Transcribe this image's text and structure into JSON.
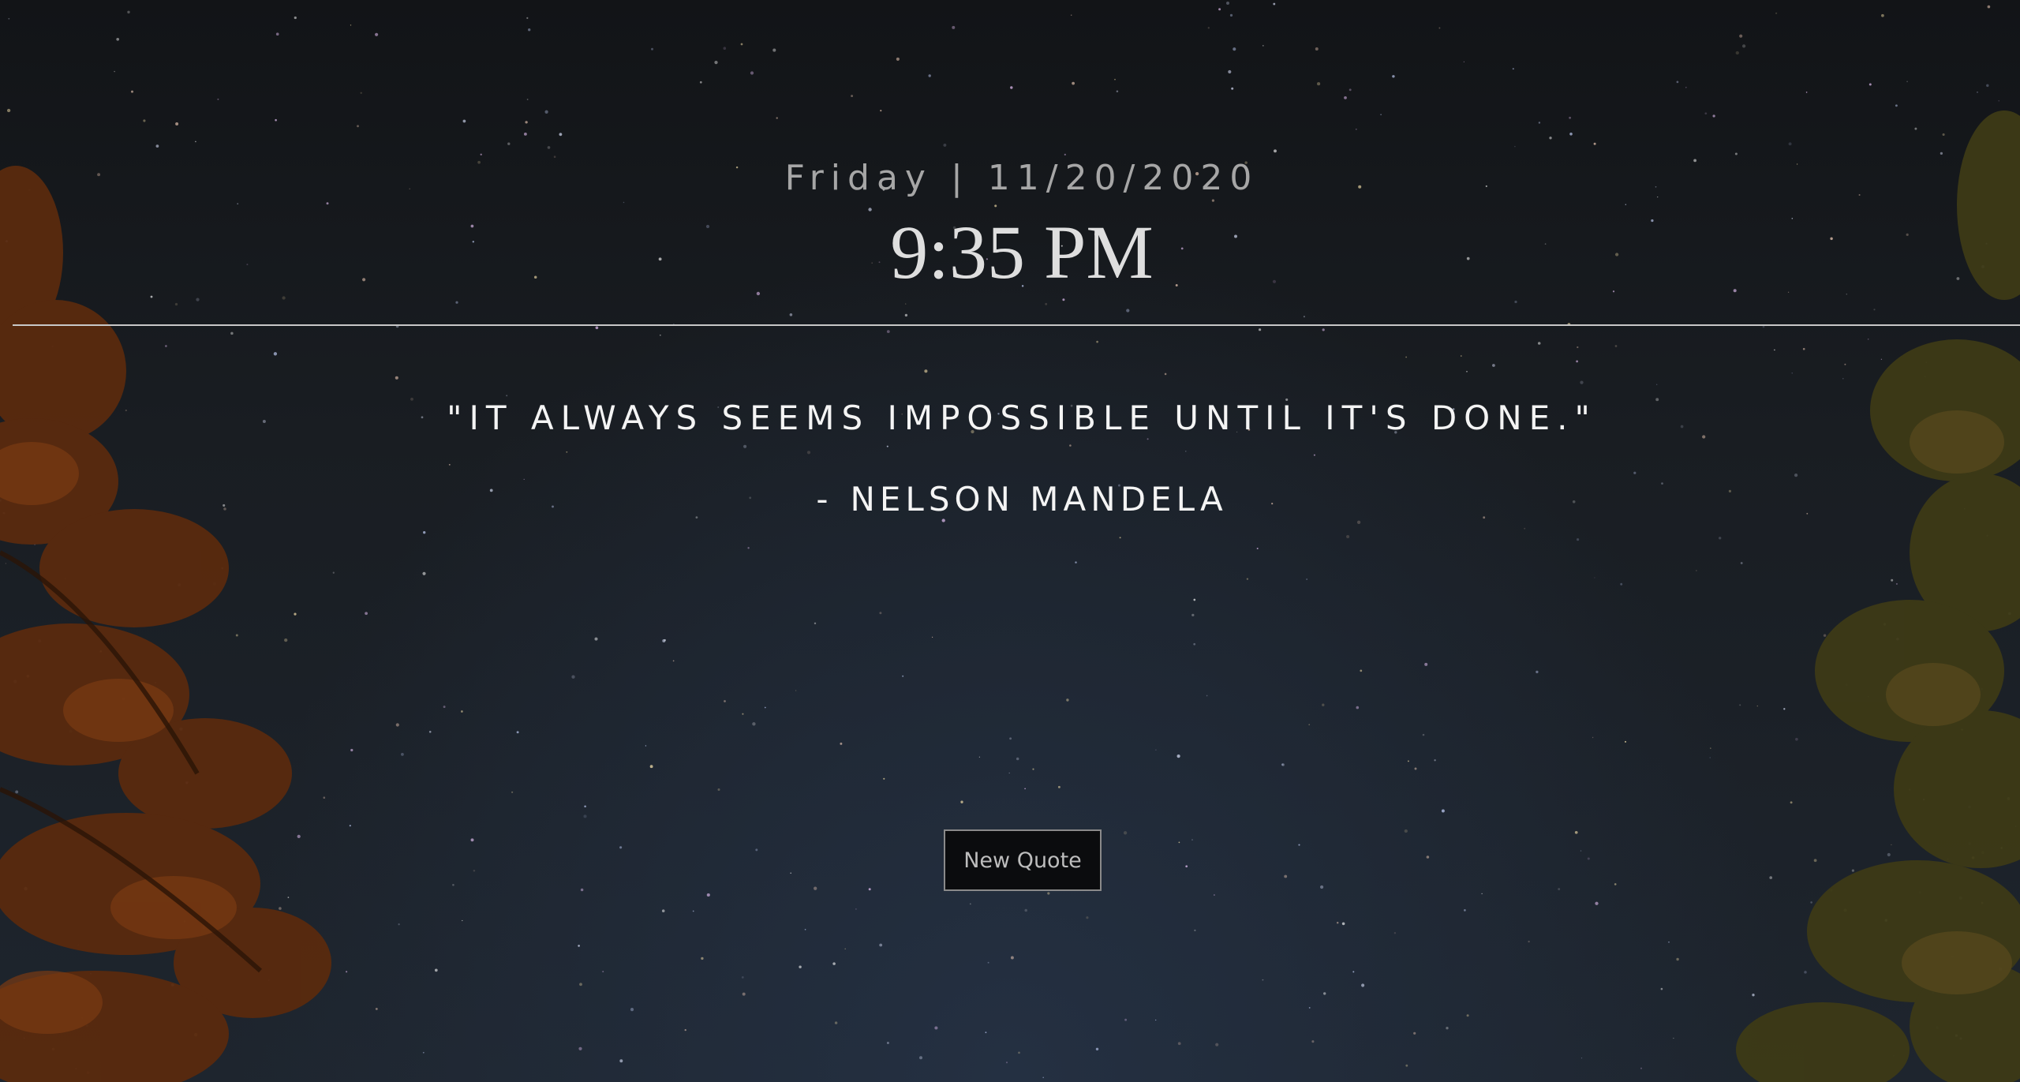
{
  "header": {
    "date": "Friday | 11/20/2020",
    "time": "9:35 PM"
  },
  "quote": {
    "text": "\"It always seems impossible until it's done.\"",
    "dash": "-",
    "author": "Nelson Mandela"
  },
  "actions": {
    "new_quote_label": "New Quote"
  },
  "colors": {
    "sky_dark": "#14171b",
    "text_light": "#f4f4f4",
    "text_muted": "#a6a6a6",
    "divider": "#c8c8c8",
    "tree_orange": "#7a3a12",
    "tree_olive": "#4e4a1a"
  },
  "background": {
    "image_subject": "night-sky-with-pine-trees-background"
  }
}
